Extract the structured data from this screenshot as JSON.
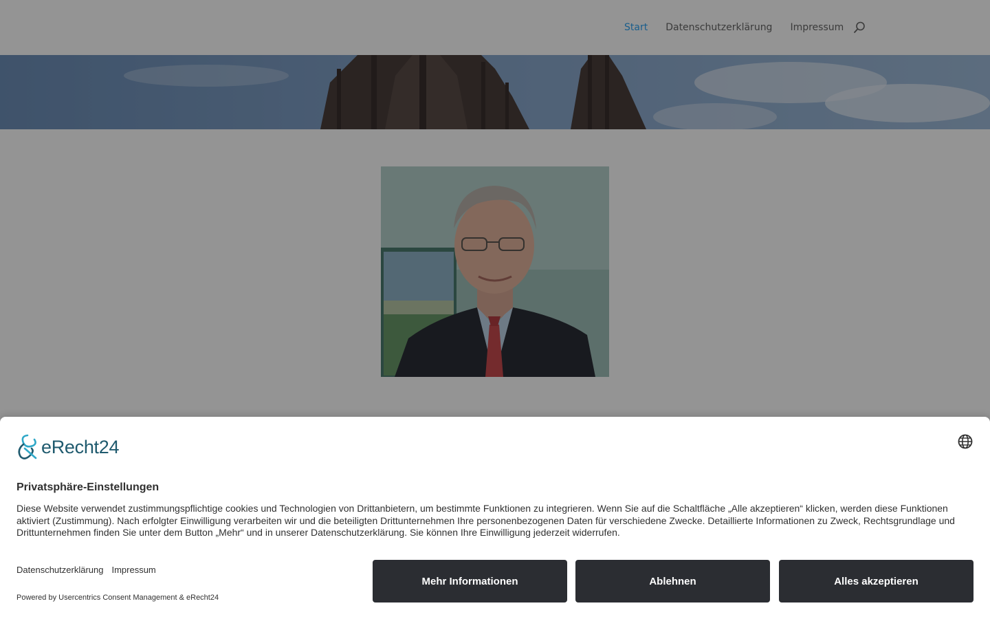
{
  "nav": {
    "items": [
      {
        "label": "Start",
        "active": true
      },
      {
        "label": "Datenschutzerklärung",
        "active": false
      },
      {
        "label": "Impressum",
        "active": false
      }
    ],
    "search_icon": "search-icon",
    "active_color": "#2ea3f2"
  },
  "consent": {
    "logo_text": "eRecht24",
    "language_icon": "globe-icon",
    "title": "Privatsphäre-Einstellungen",
    "text": "Diese Website verwendet zustimmungspflichtige cookies und Technologien von Drittanbietern, um bestimmte Funktionen zu integrieren. Wenn Sie auf die Schaltfläche „Alle akzeptieren“ klicken, werden diese Funktionen aktiviert (Zustimmung). Nach erfolgter Einwilligung verarbeiten wir und die beteiligten Drittunternehmen Ihre personenbezogenen Daten für verschiedene Zwecke. Detaillierte Informationen zu Zweck, Rechtsgrundlage und Drittunternehmen finden Sie unter dem Button „Mehr“ und in unserer Datenschutzerklärung. Sie können Ihre Einwilligung jederzeit widerrufen.",
    "links": {
      "privacy": "Datenschutzerklärung",
      "imprint": "Impressum"
    },
    "powered_by": "Powered by Usercentrics Consent Management & eRecht24",
    "buttons": {
      "more": "Mehr Informationen",
      "deny": "Ablehnen",
      "accept": "Alles akzeptieren"
    },
    "button_color": "#2b2d32"
  }
}
